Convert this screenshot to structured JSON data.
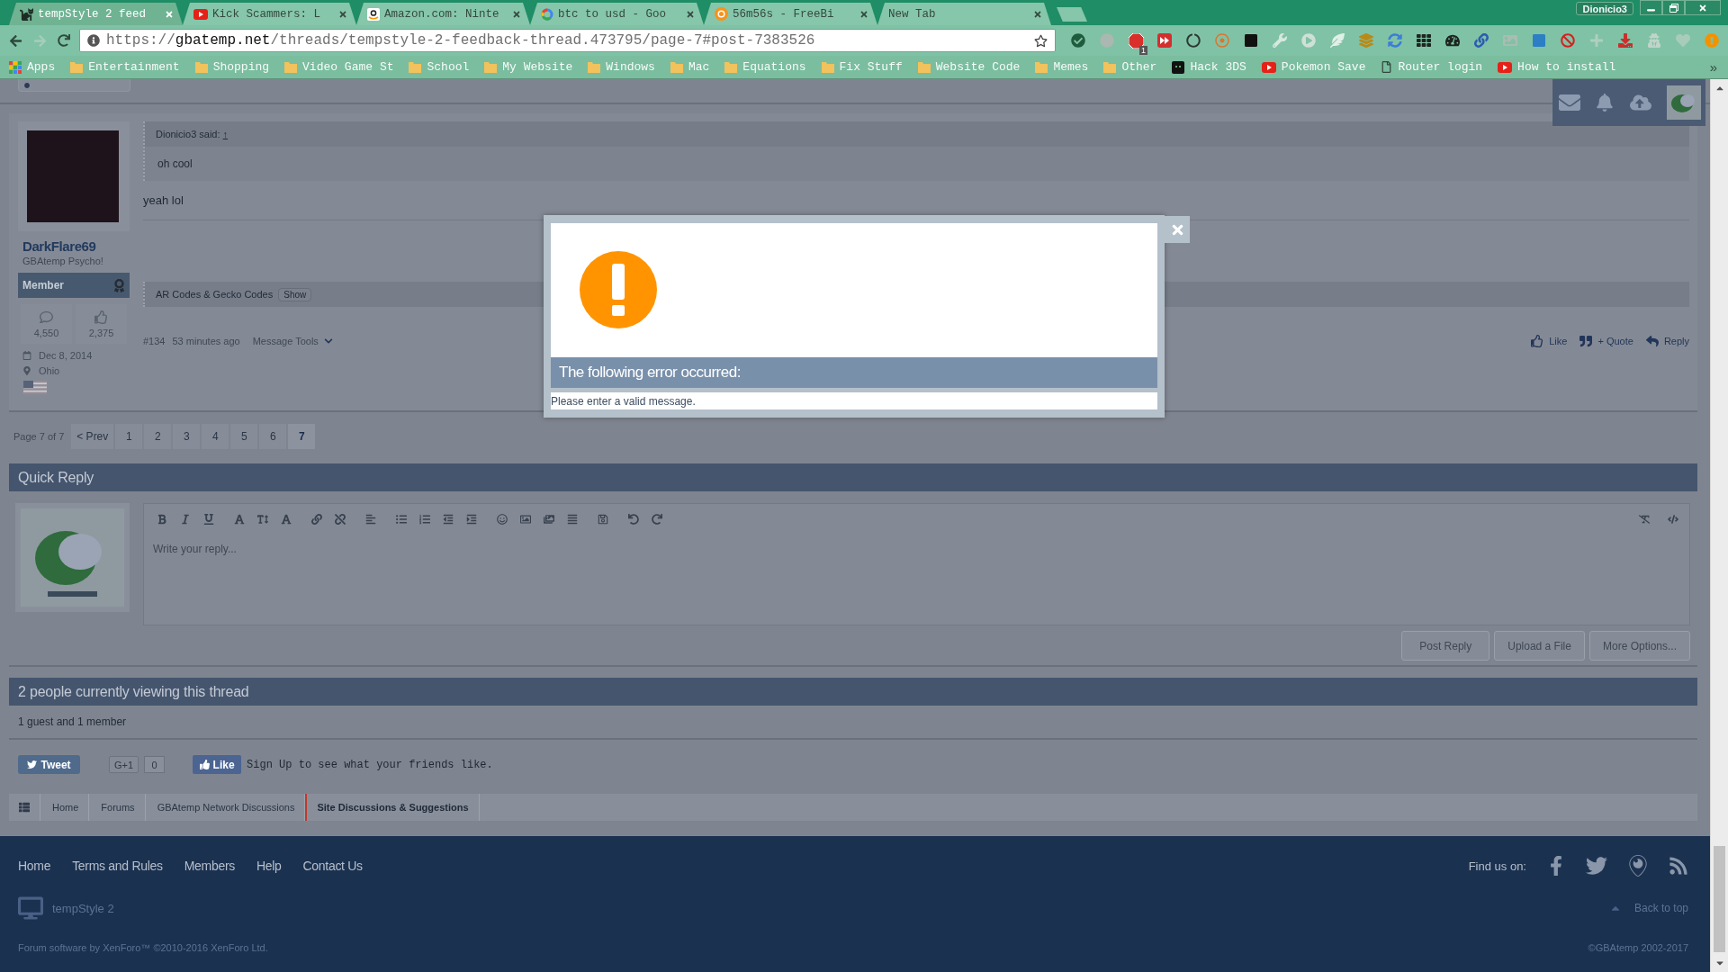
{
  "browser": {
    "tabs": [
      {
        "title": "tempStyle 2 feed",
        "kind": "site",
        "selected": true
      },
      {
        "title": "Kick Scammers: L",
        "kind": "video",
        "selected": false
      },
      {
        "title": "Amazon.com: Ninte",
        "kind": "shop",
        "selected": false
      },
      {
        "title": "btc to usd - Goo",
        "kind": "search",
        "selected": false
      },
      {
        "title": "56m56s - FreeBi",
        "kind": "coin",
        "selected": false
      },
      {
        "title": "New Tab",
        "kind": "blank",
        "selected": false
      }
    ],
    "profile": "Dionicio3",
    "url": "https://**gbatemp.net**/threads/tempstyle-2-feedback-thread.473795/page-7#post-7383526",
    "extension_badge": "1",
    "bookmarks": [
      {
        "label": "Apps",
        "kind": "apps"
      },
      {
        "label": "Entertainment",
        "kind": "folder"
      },
      {
        "label": "Shopping",
        "kind": "folder"
      },
      {
        "label": "Video Game St",
        "kind": "folder"
      },
      {
        "label": "School",
        "kind": "folder"
      },
      {
        "label": "My Website",
        "kind": "folder"
      },
      {
        "label": "Windows",
        "kind": "folder"
      },
      {
        "label": "Mac",
        "kind": "folder"
      },
      {
        "label": "Equations",
        "kind": "folder"
      },
      {
        "label": "Fix Stuff",
        "kind": "folder"
      },
      {
        "label": "Website Code",
        "kind": "folder"
      },
      {
        "label": "Memes",
        "kind": "folder"
      },
      {
        "label": "Other",
        "kind": "folder"
      },
      {
        "label": "Hack 3DS",
        "kind": "app"
      },
      {
        "label": "Pokemon Save",
        "kind": "video"
      },
      {
        "label": "Router login",
        "kind": "page"
      },
      {
        "label": "How to install",
        "kind": "video"
      }
    ],
    "bookmarks_more": "»"
  },
  "post": {
    "author": {
      "name": "DarkFlare69",
      "title": "GBAtemp Psycho!",
      "rank": "Member",
      "messages": "4,550",
      "likes": "2,375",
      "joined": "Dec 8, 2014",
      "location": "Ohio"
    },
    "quote": {
      "attribution": "Dionicio3 said:",
      "link": "↑",
      "text": "oh cool"
    },
    "message": "yeah lol",
    "signature": {
      "title": "AR Codes & Gecko Codes",
      "button": "Show"
    },
    "number": "#134",
    "time": "53 minutes ago",
    "tools": "Message Tools",
    "actions": [
      {
        "label": "Like",
        "kind": "like"
      },
      {
        "label": "+ Quote",
        "kind": "quote"
      },
      {
        "label": "Reply",
        "kind": "reply"
      }
    ]
  },
  "pagination": {
    "summary": "Page 7 of 7",
    "prev": "< Prev",
    "pages": [
      {
        "label": "1",
        "selected": false
      },
      {
        "label": "2",
        "selected": false
      },
      {
        "label": "3",
        "selected": false
      },
      {
        "label": "4",
        "selected": false
      },
      {
        "label": "5",
        "selected": false
      },
      {
        "label": "6",
        "selected": false
      },
      {
        "label": "7",
        "selected": true
      }
    ]
  },
  "quick_reply": {
    "title": "Quick Reply",
    "placeholder": "Write your reply...",
    "buttons": [
      "Post Reply",
      "Upload a File",
      "More Options..."
    ]
  },
  "viewers": {
    "title": "2 people currently viewing this thread",
    "summary": "1 guest and 1 member"
  },
  "social": {
    "tweet": "Tweet",
    "plus_one": "G+1",
    "plus_one_count": "0",
    "like": "Like",
    "like_prompt": "Sign Up to see what your friends like."
  },
  "breadcrumbs": [
    {
      "label": "Home",
      "selected": false
    },
    {
      "label": "Forums",
      "selected": false
    },
    {
      "label": "GBAtemp Network Discussions",
      "selected": false
    },
    {
      "label": "Site Discussions & Suggestions",
      "selected": true
    }
  ],
  "footer": {
    "links": [
      "Home",
      "Terms and Rules",
      "Members",
      "Help",
      "Contact Us"
    ],
    "find_us": "Find us on:",
    "style_name": "tempStyle 2",
    "back_to_top": "Back to top",
    "software": "Forum software by XenForo™ ©2010-2016 XenForo Ltd.",
    "copyright": "©GBAtemp 2002-2017"
  },
  "dialog": {
    "title": "The following error occurred:",
    "message": "Please enter a valid message."
  }
}
